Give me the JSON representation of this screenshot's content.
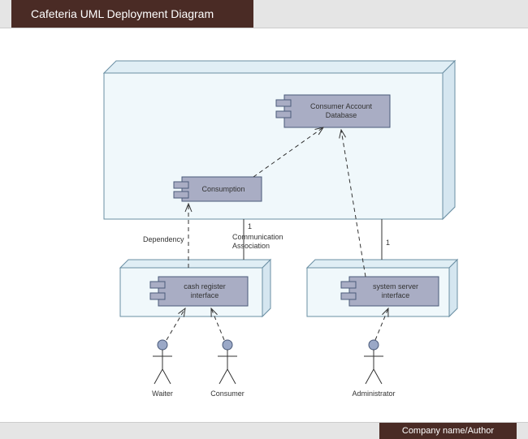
{
  "header": {
    "title": "Cafeteria UML Deployment Diagram"
  },
  "footer": {
    "text": "Company name/Author"
  },
  "components": {
    "consumerDB": "Consumer Account Database",
    "consumption": "Consumption",
    "cashRegister": "cash register interface",
    "systemServer": "system server interface"
  },
  "relations": {
    "dependency": "Dependency",
    "comm": {
      "one": "1",
      "label1": "Communication",
      "label2": "Association"
    },
    "admin_one": "1"
  },
  "actors": {
    "waiter": "Waiter",
    "consumer": "Consumer",
    "admin": "Administrator"
  }
}
